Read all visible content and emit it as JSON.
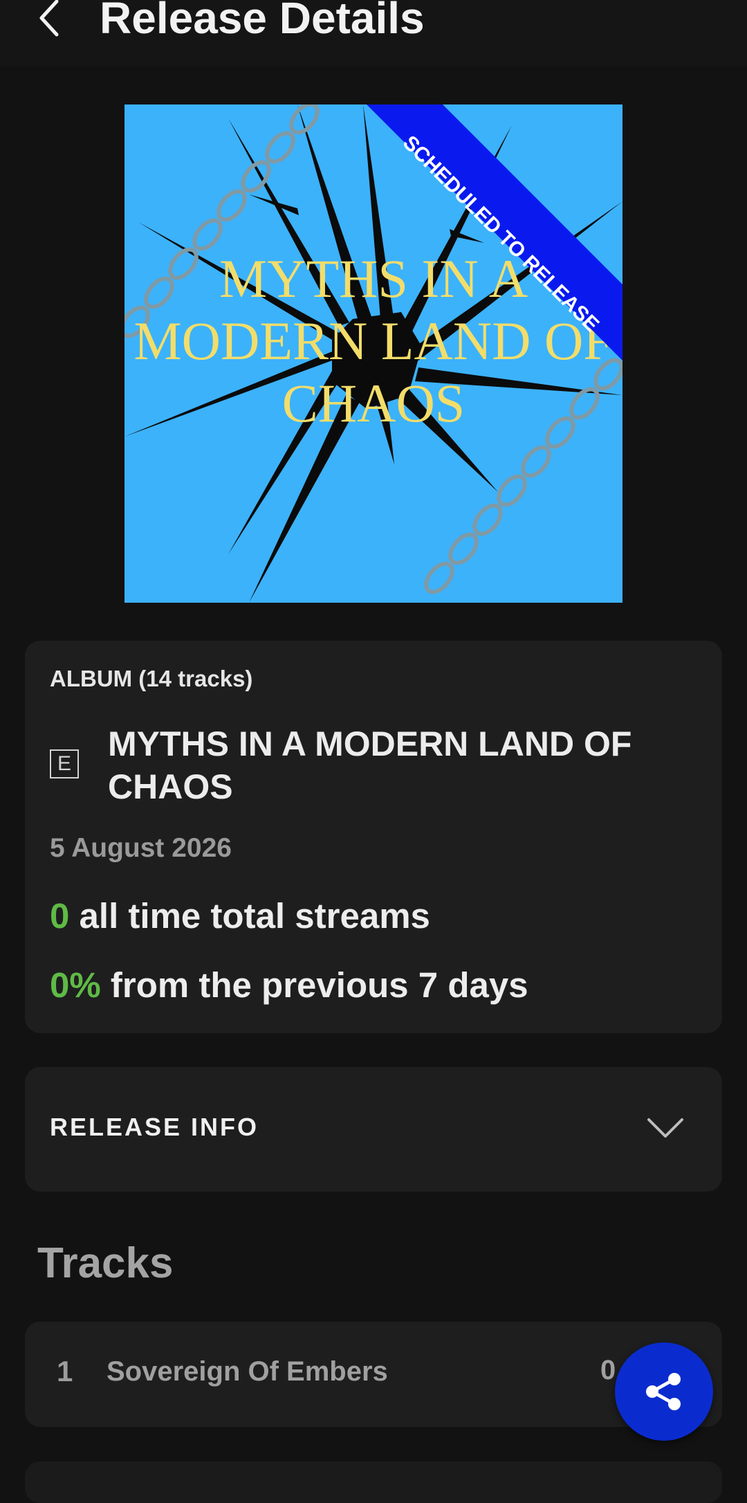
{
  "header": {
    "title": "Release Details",
    "back_icon": "chevron-left-icon"
  },
  "cover": {
    "banner_text": "SCHEDULED TO RELEASE",
    "art_title_lines": [
      "MYTHS IN A",
      "MODERN LAND OF",
      "CHAOS"
    ],
    "colors": {
      "background": "#3cb2fb",
      "banner": "#0a1aee",
      "title": "#f3dd6a"
    }
  },
  "album": {
    "type_label": "ALBUM (14 tracks)",
    "explicit_badge": "E",
    "title": "MYTHS IN A MODERN LAND OF CHAOS",
    "release_date": "5 August 2026",
    "streams_value": "0",
    "streams_label": "all time total streams",
    "change_value": "0%",
    "change_label": "from the previous 7 days"
  },
  "release_info": {
    "label": "RELEASE INFO",
    "icon": "chevron-down-icon"
  },
  "tracks": {
    "heading": "Tracks",
    "items": [
      {
        "number": "1",
        "title": "Sovereign Of Embers",
        "streams": "0"
      }
    ]
  },
  "share_button": {
    "icon": "share-icon",
    "color": "#0a2ccf"
  },
  "colors": {
    "background": "#121212",
    "card": "#1e1e1f",
    "accent_green": "#5fba46"
  }
}
